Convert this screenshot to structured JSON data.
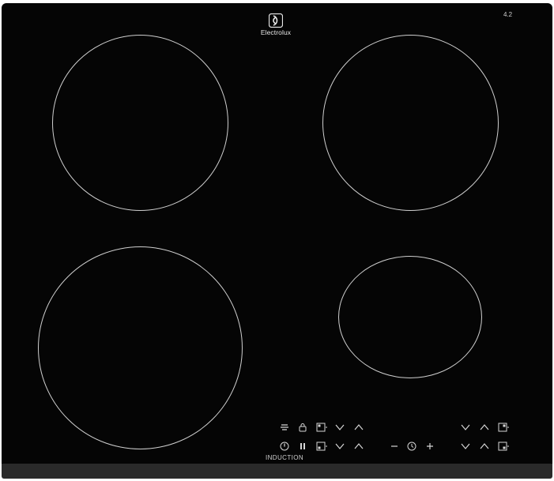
{
  "brand": {
    "name": "Electrolux",
    "logo_icon": "electrolux-logo"
  },
  "power_rating": "4.2",
  "label": "INDUCTION",
  "controls": {
    "row1": [
      {
        "name": "hob2hood-icon",
        "symbol": "hob-to-hood"
      },
      {
        "name": "lock-icon",
        "symbol": "lock"
      },
      {
        "name": "zone-select-rear-left-button",
        "symbol": "zone-rear-left"
      },
      {
        "name": "rear-left-decrease-button",
        "symbol": "chevron-down"
      },
      {
        "name": "rear-left-increase-button",
        "symbol": "chevron-up"
      },
      {
        "name": "rear-right-decrease-button",
        "symbol": "chevron-down"
      },
      {
        "name": "rear-right-increase-button",
        "symbol": "chevron-up"
      },
      {
        "name": "zone-select-rear-right-button",
        "symbol": "zone-rear-right"
      }
    ],
    "row2": [
      {
        "name": "power-button",
        "symbol": "power"
      },
      {
        "name": "pause-button",
        "symbol": "pause"
      },
      {
        "name": "zone-select-front-left-button",
        "symbol": "zone-front-left"
      },
      {
        "name": "front-left-decrease-button",
        "symbol": "chevron-down"
      },
      {
        "name": "front-left-increase-button",
        "symbol": "chevron-up"
      },
      {
        "name": "timer-minus-button",
        "symbol": "minus"
      },
      {
        "name": "timer-clock-icon",
        "symbol": "clock"
      },
      {
        "name": "timer-plus-button",
        "symbol": "plus"
      },
      {
        "name": "front-right-decrease-button",
        "symbol": "chevron-down"
      },
      {
        "name": "front-right-increase-button",
        "symbol": "chevron-up"
      },
      {
        "name": "zone-select-front-right-button",
        "symbol": "zone-front-right"
      }
    ]
  },
  "colors": {
    "glass": "#050505",
    "marking": "#d6d6d6",
    "frame": "#2a2a2a"
  }
}
